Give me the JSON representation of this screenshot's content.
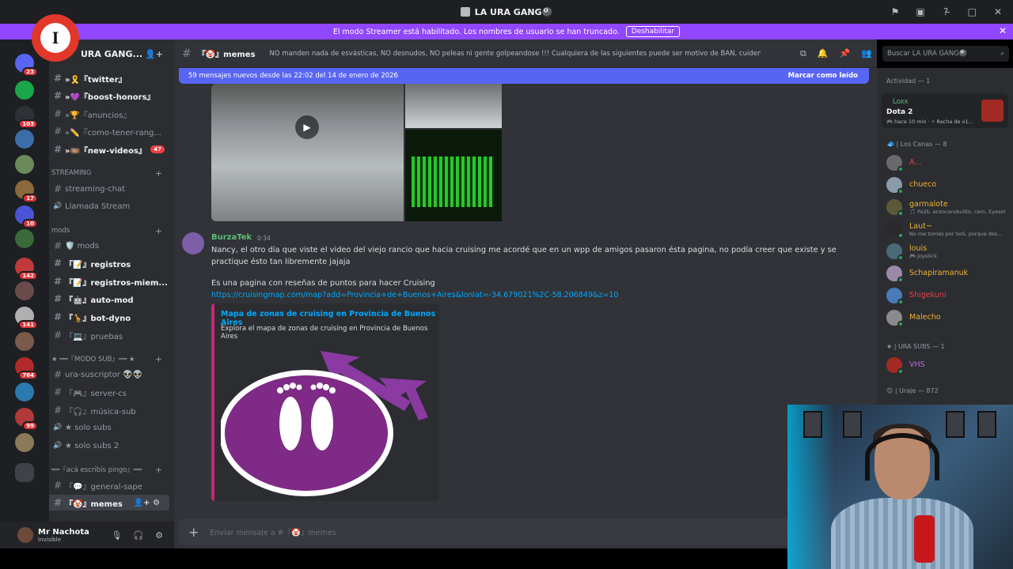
{
  "window": {
    "title": "LA URA GANG🎱"
  },
  "streamer_banner": {
    "message": "El modo Streamer está habilitado. Los nombres de usuario se han truncado.",
    "button_label": "Deshabilitar"
  },
  "guilds": [
    {
      "name": "guild-1",
      "badge": "23"
    },
    {
      "name": "guild-2",
      "badge": ""
    },
    {
      "name": "guild-3",
      "badge": "103"
    },
    {
      "name": "guild-4",
      "badge": ""
    },
    {
      "name": "guild-5",
      "badge": ""
    },
    {
      "name": "guild-6",
      "badge": "17"
    },
    {
      "name": "guild-7",
      "badge": "10"
    },
    {
      "name": "guild-8",
      "badge": ""
    },
    {
      "name": "guild-9",
      "badge": "142"
    },
    {
      "name": "guild-10",
      "badge": ""
    },
    {
      "name": "guild-11",
      "badge": "141"
    },
    {
      "name": "guild-12",
      "badge": ""
    },
    {
      "name": "guild-13",
      "badge": "764"
    },
    {
      "name": "guild-14",
      "badge": ""
    },
    {
      "name": "guild-15",
      "badge": "99"
    },
    {
      "name": "guild-16",
      "badge": ""
    }
  ],
  "server": {
    "name": "URA GANG..."
  },
  "channels": [
    {
      "label": "»🎗️『twitter』",
      "bold": true
    },
    {
      "label": "»💜『boost-honors』",
      "bold": true
    },
    {
      "label": "»🏆『anuncios』",
      "bold": false
    },
    {
      "label": "»✏️『como-tener-rang...",
      "bold": false
    },
    {
      "label": "»🎞️『new-videos』",
      "bold": true,
      "badge": "47"
    }
  ],
  "categories": {
    "streaming": "STREAMING",
    "mods": "mods",
    "modo_sub": "★ ══『MODO SUB』══ ★",
    "aca_escribis": "══『acá escribís pingo』══"
  },
  "streaming_channels": [
    {
      "label": "streaming-chat"
    },
    {
      "label": "Llamada Stream"
    }
  ],
  "mod_channels": [
    {
      "label": "🛡️ mods",
      "bold": false
    },
    {
      "label": "『📝』registros",
      "bold": true
    },
    {
      "label": "『📝』registros-miem...",
      "bold": true
    },
    {
      "label": "『🤖』auto-mod",
      "bold": true
    },
    {
      "label": "『🦒』bot-dyno",
      "bold": true
    },
    {
      "label": "『💻』pruebas",
      "bold": false
    }
  ],
  "sub_channels": [
    {
      "label": "ura-suscriptor 👽👽"
    },
    {
      "label": "『🎮』server-cs"
    },
    {
      "label": "『🎧』música-sub"
    },
    {
      "label": "★ solo subs"
    },
    {
      "label": "★ solo subs 2"
    }
  ],
  "misc_channels": [
    {
      "label": "『💬』general-sape"
    },
    {
      "label": "『🤡』memes"
    }
  ],
  "user_panel": {
    "name": "Mr Nachota",
    "status": "Invisible"
  },
  "chat_header": {
    "channel": "『🤡』memes",
    "topic": "NO manden nada de esvásticas, NO desnudos, NO peleas ni gente golpeandose !!! Cualquiera de las siguientes puede ser motivo de BAN, cuiden el stream!"
  },
  "new_messages_bar": {
    "text": "59 mensajes nuevos desde las 22:02 del 14 de enero de 2026",
    "action": "Marcar como leído"
  },
  "message": {
    "author": "BurzaTek",
    "time": "0:34",
    "text": "Nancy, el otro día que viste el video del viejo rancio que hacia cruising me acordé que en un wpp de amigos pasaron ésta pagina, no podía creer que existe y se practique ésto tan libremente jajaja",
    "text2": "Es una pagina con reseñas de puntos para hacer Cruising",
    "link": "https://cruisingmap.com/map?add=Provincia+de+Buenos+Aires&lonlat=-34.679021%2C-58.206849&z=10",
    "embed_title": "Mapa de zonas de cruising en Provincia de Buenos Aires",
    "embed_desc": "Explora el mapa de zonas de cruising en Provincia de Buenos Aires"
  },
  "composer": {
    "placeholder": "Enviar mensaje a #『🤡』memes"
  },
  "search": {
    "placeholder": "Buscar LA URA GANG🎱"
  },
  "members_panel": {
    "activity_header": "Actividad — 1",
    "activity": {
      "name": "Loxx",
      "game": "Dota 2",
      "meta": "🎮 hace 10 min · ⚡ Racha de x1..."
    },
    "group1": "🧢 | Los Canas — 8",
    "group1_members": [
      {
        "name": "A...",
        "status": "",
        "color": "#f23f43"
      },
      {
        "name": "chueco",
        "status": "",
        "color": "#f0b232"
      },
      {
        "name": "garmalote",
        "status": "🎵 Pa2k, enzocerobullto, cero, Eyeso!",
        "color": "#f0b232"
      },
      {
        "name": "Laut~",
        "status": "No me tomés por SoS, porque des...",
        "color": "#f0b232"
      },
      {
        "name": "louis",
        "status": "🎮 Joystick",
        "color": "#f0b232"
      },
      {
        "name": "Schapiramanuk",
        "status": "",
        "color": "#f0b232"
      },
      {
        "name": "Shigekuni",
        "status": "",
        "color": "#f23f43"
      },
      {
        "name": "Malecho",
        "status": "",
        "color": "#f0b232"
      }
    ],
    "group2": "★ | URA SUBS — 1",
    "group2_members": [
      {
        "name": "VHS",
        "status": "",
        "color": "#c267e6"
      }
    ],
    "group3": "😊 | Uraje — 872"
  }
}
